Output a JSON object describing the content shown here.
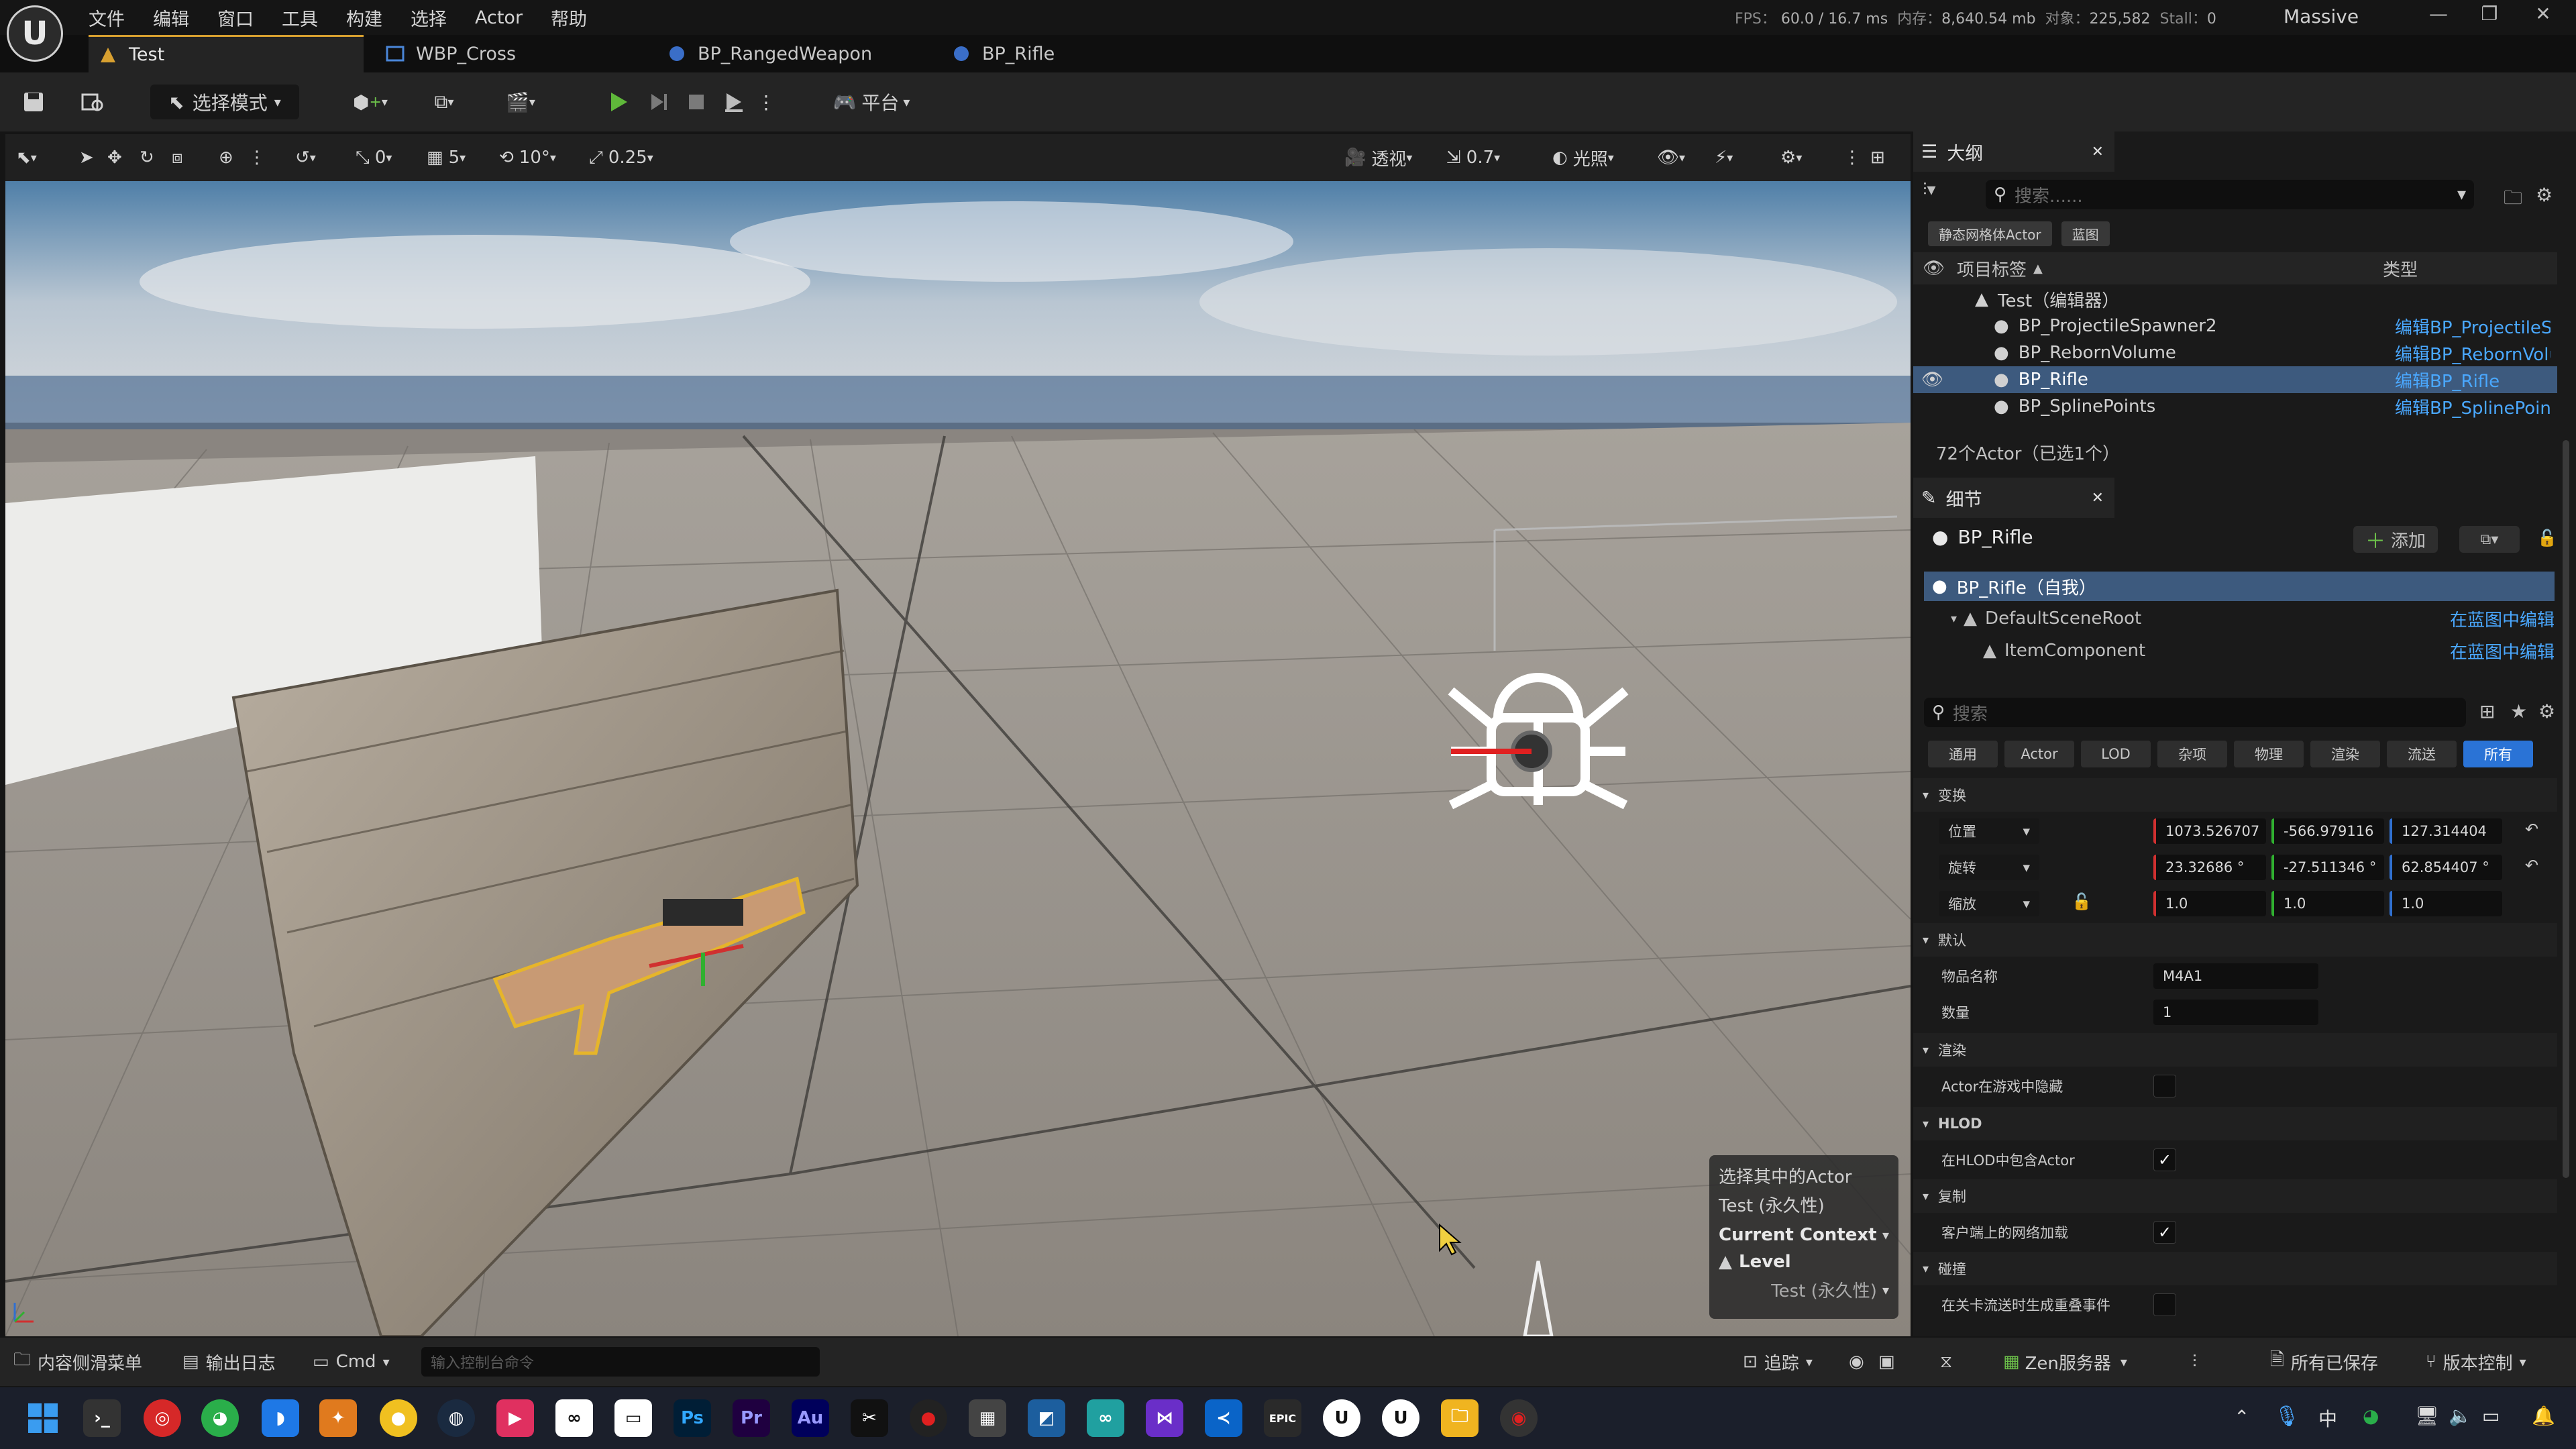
{
  "titlebar": {
    "menu": [
      "文件",
      "编辑",
      "窗口",
      "工具",
      "构建",
      "选择",
      "Actor",
      "帮助"
    ],
    "fps_label": "FPS：",
    "fps_value": "60.0",
    "frame_time": "/ 16.7 ms",
    "mem_label": "内存：",
    "mem_value": "8,640.54 mb",
    "objects_label": "对象：",
    "objects_value": "225,582",
    "stall_label": "Stall：",
    "stall_value": "0",
    "project": "Massive",
    "minimize": "—",
    "restore": "❐",
    "close": "✕",
    "logo": "U"
  },
  "tabs": [
    {
      "label": "Test"
    },
    {
      "label": "WBP_Cross"
    },
    {
      "label": "BP_RangedWeapon"
    },
    {
      "label": "BP_Rifle"
    }
  ],
  "main_toolbar": {
    "select_mode": "选择模式",
    "platform": "平台"
  },
  "viewport_toolbar": {
    "snap_translate": "0",
    "grid_size": "5",
    "rotate_snap": "10°",
    "scale_snap": "0.25",
    "view_mode_perspective": "透视",
    "camera_speed": "0.7",
    "lit_mode": "光照"
  },
  "context": {
    "line1": "选择其中的Actor",
    "line2": "Test (永久性)",
    "current_context": "Current Context",
    "level": "Level",
    "level_value": "Test (永久性)"
  },
  "outliner": {
    "tab": "大纲",
    "search_placeholder": "搜索......",
    "filters": [
      "静态网格体Actor",
      "蓝图"
    ],
    "col_label": "项目标签",
    "col_type": "类型",
    "root": "Test（编辑器）",
    "rows": [
      {
        "label": "BP_ProjectileSpawner2",
        "type": "编辑BP_ProjectileSp"
      },
      {
        "label": "BP_RebornVolume",
        "type": "编辑BP_RebornVolu"
      },
      {
        "label": "BP_Rifle",
        "type": "编辑BP_Rifle"
      },
      {
        "label": "BP_SplinePoints",
        "type": "编辑BP_SplinePoint"
      }
    ],
    "count": "72个Actor（已选1个）"
  },
  "details": {
    "tab": "细节",
    "actor_name": "BP_Rifle",
    "add_button": "添加",
    "self_row": "BP_Rifle（自我）",
    "components": [
      {
        "label": "DefaultSceneRoot",
        "link": "在蓝图中编辑"
      },
      {
        "label": "ItemComponent",
        "link": "在蓝图中编辑"
      }
    ],
    "search_placeholder": "搜索",
    "categories": [
      "通用",
      "Actor",
      "LOD",
      "杂项",
      "物理",
      "渲染",
      "流送",
      "所有"
    ],
    "transform_header": "变换",
    "location_label": "位置",
    "location": [
      "1073.526707",
      "-566.979116",
      "127.314404"
    ],
    "rotation_label": "旋转",
    "rotation": [
      "23.32686 °",
      "-27.511346 °",
      "62.854407 °"
    ],
    "scale_label": "缩放",
    "scale": [
      "1.0",
      "1.0",
      "1.0"
    ],
    "default_header": "默认",
    "item_name_label": "物品名称",
    "item_name_value": "M4A1",
    "quantity_label": "数量",
    "quantity_value": "1",
    "render_header": "渲染",
    "hidden_in_game_label": "Actor在游戏中隐藏",
    "hlod_header": "HLOD",
    "include_in_hlod_label": "在HLOD中包含Actor",
    "replication_header": "复制",
    "net_load_label": "客户端上的网络加载",
    "collision_header": "碰撞",
    "overlap_label": "在关卡流送时生成重叠事件"
  },
  "statusbar": {
    "content_drawer": "内容侧滑菜单",
    "output_log": "输出日志",
    "cmd": "Cmd",
    "console_placeholder": "输入控制台命令",
    "trace": "追踪",
    "zen": "Zen服务器",
    "saved": "所有已保存",
    "source_control": "版本控制"
  },
  "taskbar": {
    "ime": "中"
  },
  "colors": {
    "accent_blue": "#2a73d6",
    "link": "#4aa8ff",
    "selection": "#3d5a7e"
  }
}
